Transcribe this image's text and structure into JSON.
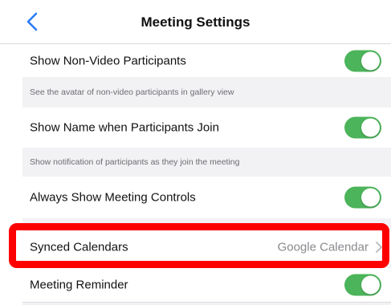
{
  "header": {
    "title": "Meeting Settings",
    "back_icon": "chevron-left-icon"
  },
  "settings": {
    "show_non_video": {
      "label": "Show Non-Video Participants",
      "enabled": true,
      "description": "See the avatar of non-video participants in gallery view"
    },
    "show_name_join": {
      "label": "Show Name when Participants Join",
      "enabled": true,
      "description": "Show notification of participants as they join the meeting"
    },
    "always_show_controls": {
      "label": "Always Show Meeting Controls",
      "enabled": true
    },
    "synced_calendars": {
      "label": "Synced Calendars",
      "value": "Google Calendar",
      "icon": "chevron-right-icon"
    },
    "meeting_reminder": {
      "label": "Meeting Reminder",
      "enabled": true
    }
  },
  "colors": {
    "accent": "#2a7cf6",
    "toggle_on": "#4cb45a",
    "highlight": "#ff0000",
    "background": "#f2f2f5"
  }
}
